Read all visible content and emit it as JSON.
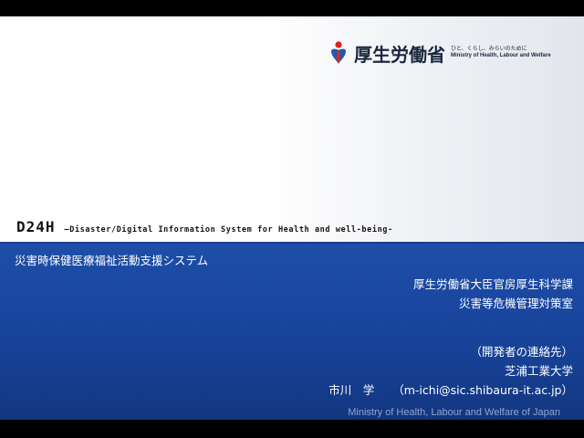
{
  "logo": {
    "name": "厚生労働省",
    "sub_jp": "ひと、くらし、みらいのために",
    "sub_en": "Ministry of Health, Labour and Welfare",
    "colors": {
      "red": "#e2231a",
      "blue": "#1e5bb5"
    }
  },
  "title": {
    "code": "D24H",
    "description": "–Disaster/Digital Information System for Health and well-being-"
  },
  "subtitle": "災害時保健医療福祉活動支援システム",
  "organization": {
    "line1": "厚生労働省大臣官房厚生科学課",
    "line2": "災害等危機管理対策室"
  },
  "contact": {
    "heading": "（開発者の連絡先）",
    "affiliation": "芝浦工業大学",
    "person_name": "市川　学",
    "person_email": "（m-ichi@sic.shibaura-it.ac.jp）"
  },
  "footer": {
    "ministry_en": "Ministry of Health, Labour and Welfare of Japan"
  },
  "colors": {
    "band_blue": "#1a47a0",
    "text_white": "#ffffff",
    "footer_text": "#8ea4cc"
  }
}
